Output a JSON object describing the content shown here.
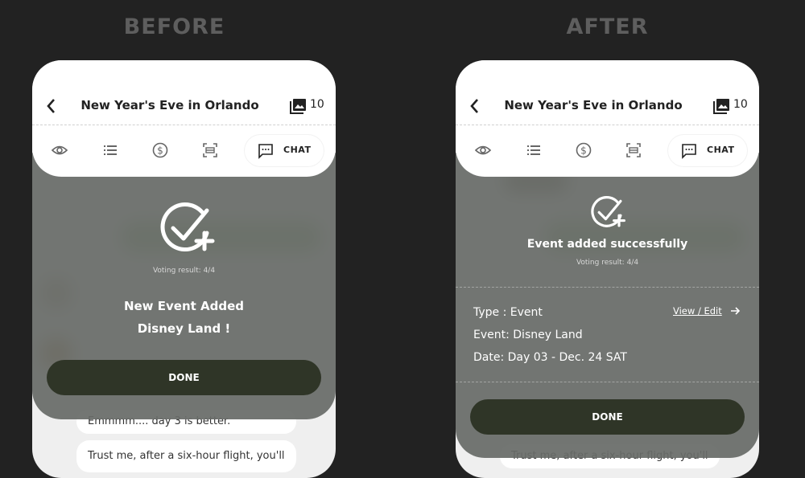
{
  "labels": {
    "before": "BEFORE",
    "after": "AFTER"
  },
  "header": {
    "title": "New Year's Eve in Orlando",
    "photo_count": "10",
    "chat_tab": "CHAT"
  },
  "before_modal": {
    "voting": "Voting result: 4/4",
    "line1": "New Event Added",
    "line2": "Disney Land !",
    "done": "DONE"
  },
  "after_modal": {
    "success": "Event added successfully",
    "voting": "Voting result: 4/4",
    "type": "Type : Event",
    "event": "Event: Disney Land",
    "date": "Date:  Day 03 - Dec. 24 SAT",
    "view_edit": "View / Edit",
    "done": "DONE"
  },
  "chat": {
    "msg1": "Emmmm.... day 3 is better.",
    "msg2": "Trust me, after a six-hour flight, you'll"
  },
  "icons": [
    "back-icon",
    "photo-icon",
    "eye-icon",
    "list-icon",
    "dollar-icon",
    "scan-icon",
    "chat-icon",
    "check-add-icon",
    "arrow-right-icon"
  ],
  "colors": {
    "background": "#222222",
    "button": "#2f3527",
    "overlay": "#686c68"
  }
}
